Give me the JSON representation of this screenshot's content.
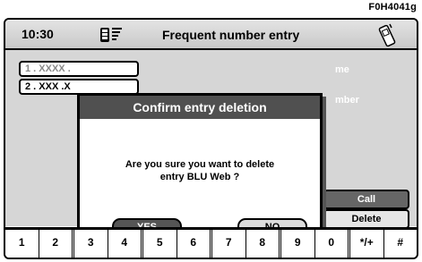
{
  "figure_code": "F0H4041g",
  "statusbar": {
    "time": "10:30",
    "title": "Frequent number entry",
    "sim_icon": "sim-card-signal-icon",
    "phone_icon": "mobile-phone-icon"
  },
  "entries": [
    {
      "label": "1 . XXXX ."
    },
    {
      "label": "2 . XXX .X"
    }
  ],
  "side": {
    "label_1": "me",
    "label_2": "mber",
    "call_label": "Call",
    "delete_label": "Delete"
  },
  "dialog": {
    "title": "Confirm entry deletion",
    "message_line1": "Are you sure you want to delete",
    "message_line2": "entry BLU Web ?",
    "yes_label": "YES",
    "no_label": "NO"
  },
  "keypad": [
    "1",
    "2",
    "3",
    "4",
    "5",
    "6",
    "7",
    "8",
    "9",
    "0",
    "*/+",
    "#"
  ]
}
